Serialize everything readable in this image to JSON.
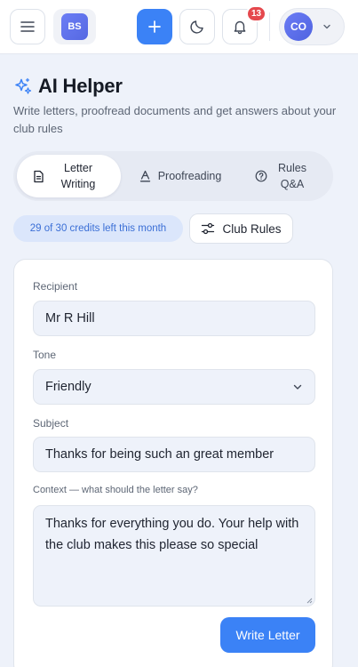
{
  "topbar": {
    "org_initials": "BS",
    "notification_count": "13",
    "user_initials": "CO",
    "icons": {
      "menu": "hamburger-menu-icon",
      "add": "plus-icon",
      "theme": "moon-icon",
      "notifications": "bell-icon",
      "user_menu": "chevron-down-icon"
    },
    "accent_color": "#3b82f6",
    "badge_color": "#e5484d"
  },
  "header": {
    "title": "AI Helper",
    "title_icon": "sparkles-icon",
    "subtitle": "Write letters, proofread documents and get answers about your club rules"
  },
  "tabs": [
    {
      "label": "Letter Writing",
      "icon": "document-icon",
      "active": true
    },
    {
      "label": "Proofreading",
      "icon": "text-format-icon",
      "active": false
    },
    {
      "label": "Rules Q&A",
      "icon": "help-circle-icon",
      "active": false
    }
  ],
  "credits": {
    "text": "29 of 30 credits left this month",
    "used": 1,
    "remaining": 29,
    "total": 30
  },
  "club_rules_button": {
    "label": "Club Rules",
    "icon": "sliders-icon"
  },
  "form": {
    "recipient": {
      "label": "Recipient",
      "value": "Mr R Hill"
    },
    "tone": {
      "label": "Tone",
      "value": "Friendly"
    },
    "subject": {
      "label": "Subject",
      "value": "Thanks for being such an great member"
    },
    "context": {
      "label": "Context — what should the letter say?",
      "value": "Thanks for everything you do. Your help with the club makes this please so special"
    },
    "submit_label": "Write Letter"
  }
}
